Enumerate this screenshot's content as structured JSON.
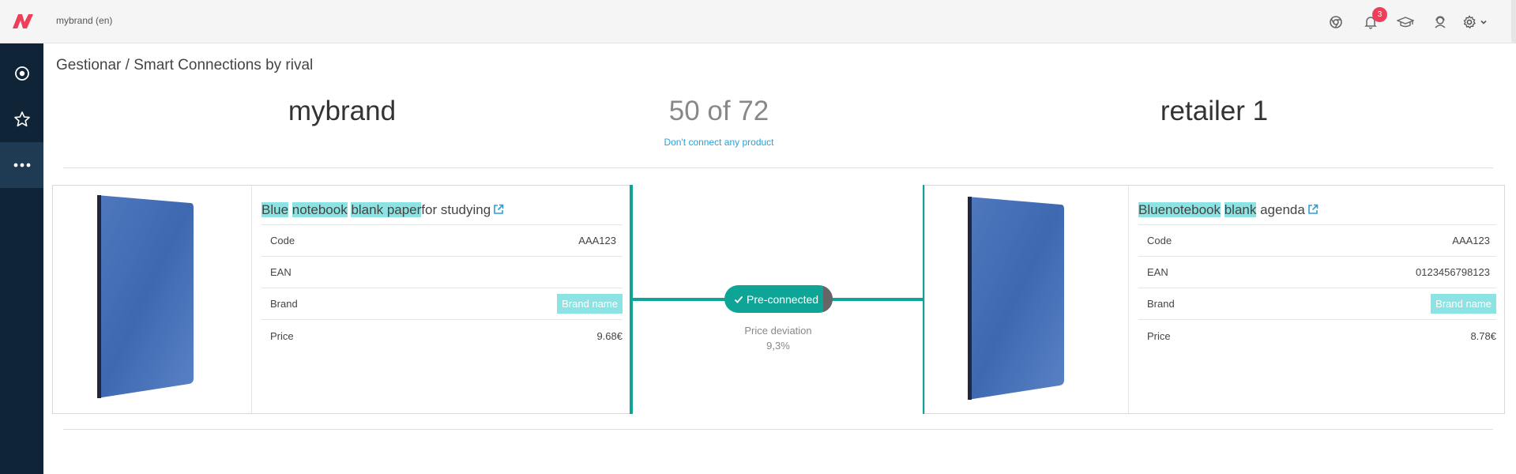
{
  "topbar": {
    "brand_label": "mybrand (en)",
    "notifications_count": "3",
    "icons": [
      "chrome-icon",
      "bell-icon",
      "graduation-cap-icon",
      "support-agent-icon",
      "gear-icon",
      "chevron-down-icon"
    ]
  },
  "sidebar": {
    "items": [
      {
        "icon": "target-icon",
        "active": false
      },
      {
        "icon": "star-icon",
        "active": false
      },
      {
        "icon": "more-dots-icon",
        "active": true
      }
    ]
  },
  "page": {
    "title": "Gestionar / Smart Connections by rival",
    "left_name": "mybrand",
    "count_text": "50 of 72",
    "right_name": "retailer 1",
    "dont_connect": "Don't connect any product"
  },
  "left_product": {
    "title_parts": [
      {
        "text": "Blue",
        "hl": true
      },
      {
        "text": " ",
        "hl": false
      },
      {
        "text": "notebook",
        "hl": true
      },
      {
        "text": " ",
        "hl": false
      },
      {
        "text": "blank paper",
        "hl": true
      },
      {
        "text": "for studying",
        "hl": false
      }
    ],
    "rows": [
      {
        "label": "Code",
        "value": "AAA123"
      },
      {
        "label": "EAN",
        "value": ""
      },
      {
        "label": "Brand",
        "value": "Brand name",
        "pill": true
      },
      {
        "label": "Price",
        "value": "9.68€"
      }
    ]
  },
  "right_product": {
    "title_parts": [
      {
        "text": "Bluenotebook",
        "hl": true
      },
      {
        "text": " ",
        "hl": false
      },
      {
        "text": "blank",
        "hl": true
      },
      {
        "text": " agenda",
        "hl": false
      }
    ],
    "rows": [
      {
        "label": "Code",
        "value": "AAA123"
      },
      {
        "label": "EAN",
        "value": "0123456798123"
      },
      {
        "label": "Brand",
        "value": "Brand name",
        "pill": true
      },
      {
        "label": "Price",
        "value": "8.78€"
      }
    ]
  },
  "connection": {
    "status": "Pre-connected",
    "deviation_label": "Price deviation",
    "deviation_value": "9,3%"
  },
  "colors": {
    "accent": "#0fa596",
    "highlight": "#8ce3e3",
    "sidebar": "#0f2436",
    "link": "#2a9fd8",
    "badge": "#ef3e5a"
  }
}
